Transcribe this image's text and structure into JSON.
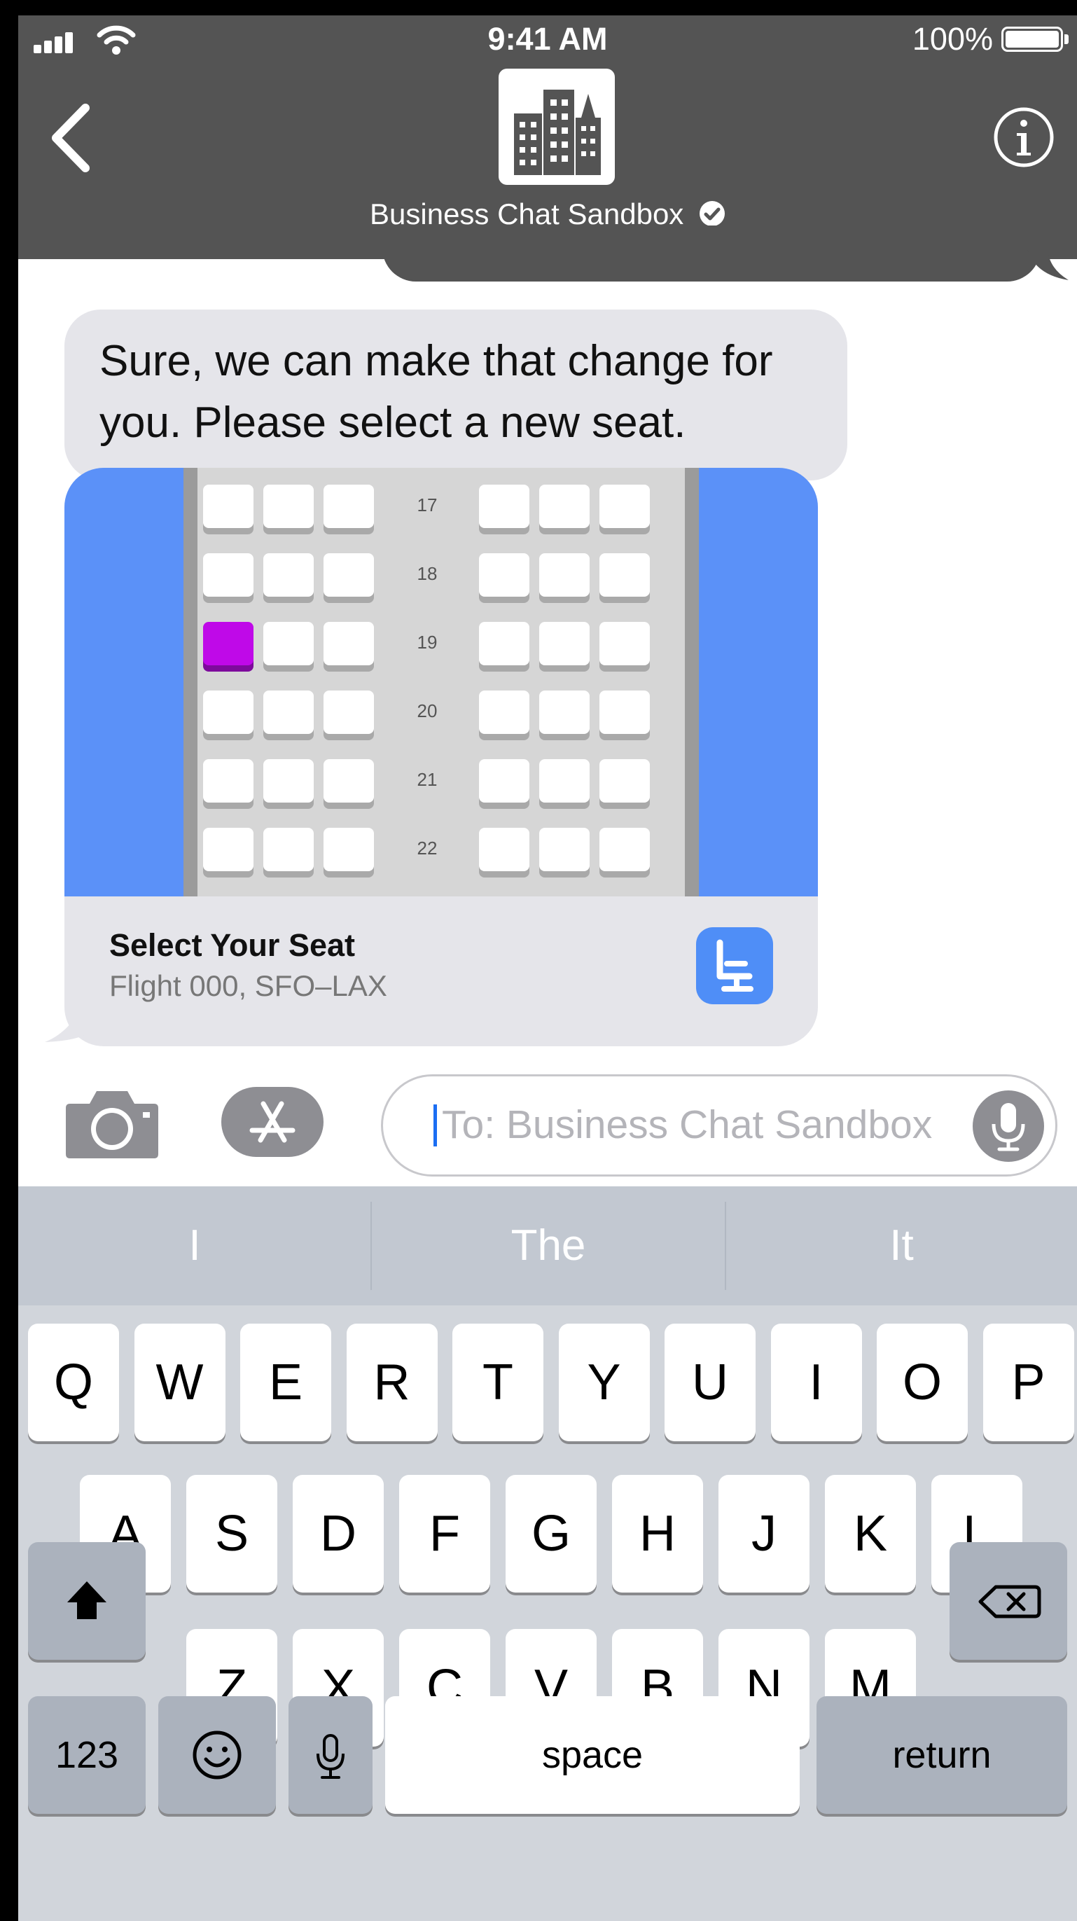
{
  "status_bar": {
    "time": "9:41 AM",
    "battery_percent": "100%"
  },
  "header": {
    "business_name": "Business Chat Sandbox",
    "verified": true
  },
  "message": {
    "text": "Sure, we can make that change for you. Please select a new seat."
  },
  "seat_card": {
    "title": "Select Your Seat",
    "subtitle": "Flight 000, SFO–LAX",
    "rows": [
      "17",
      "18",
      "19",
      "20",
      "21",
      "22"
    ],
    "selected_seat": {
      "row": "19",
      "seat_index": 0
    }
  },
  "input": {
    "placeholder": "To: Business Chat Sandbox"
  },
  "predictions": [
    "I",
    "The",
    "It"
  ],
  "keyboard": {
    "row1": [
      "Q",
      "W",
      "E",
      "R",
      "T",
      "Y",
      "U",
      "I",
      "O",
      "P"
    ],
    "row2": [
      "A",
      "S",
      "D",
      "F",
      "G",
      "H",
      "J",
      "K",
      "L"
    ],
    "row3": [
      "Z",
      "X",
      "C",
      "V",
      "B",
      "N",
      "M"
    ],
    "numbers_label": "123",
    "space_label": "space",
    "return_label": "return"
  },
  "colors": {
    "header_bg": "#545454",
    "seat_selected": "#bf09e8",
    "map_bg": "#5b91f8",
    "app_icon": "#4f8ef7"
  }
}
